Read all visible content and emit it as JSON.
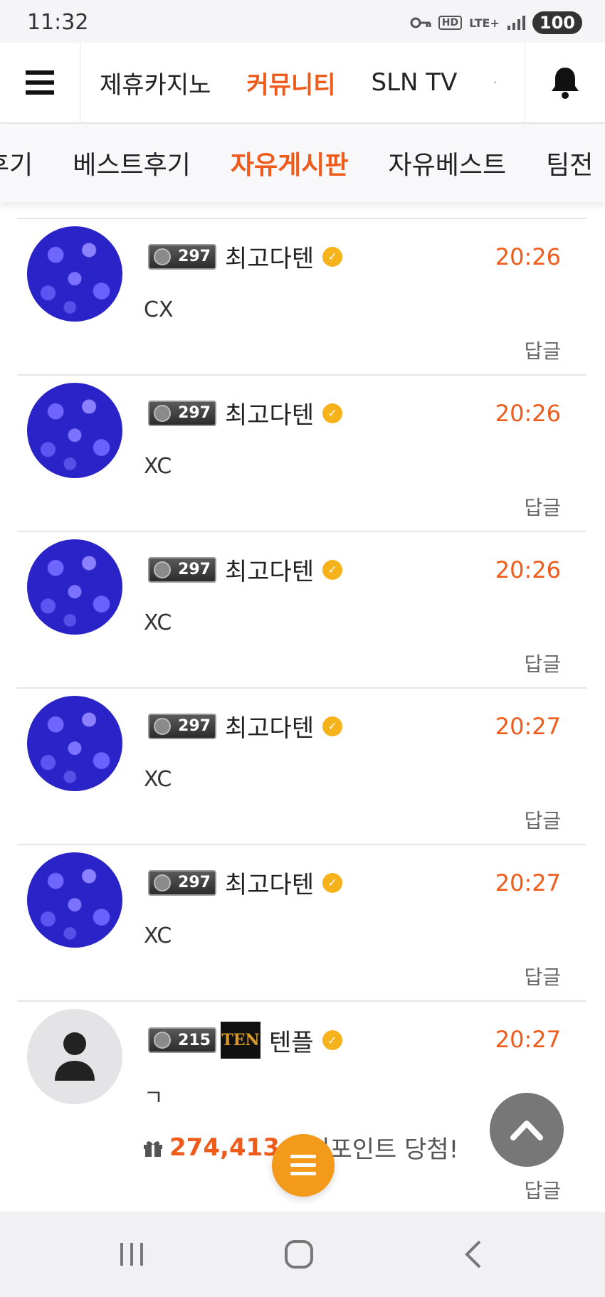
{
  "status": {
    "time": "11:32",
    "battery": "100",
    "network": "LTE+",
    "hd": "HD"
  },
  "topnav": {
    "tabs": [
      "제휴카지노",
      "커뮤니티",
      "SLN TV"
    ],
    "more": "·"
  },
  "subnav": {
    "items": [
      "후기",
      "베스트후기",
      "자유게시판",
      "자유베스트",
      "팀전"
    ]
  },
  "comments": [
    {
      "level": "297",
      "nickname": "최고다텐",
      "time": "20:26",
      "text": "CX",
      "reply": "답글"
    },
    {
      "level": "297",
      "nickname": "최고다텐",
      "time": "20:26",
      "text": "XC",
      "reply": "답글"
    },
    {
      "level": "297",
      "nickname": "최고다텐",
      "time": "20:26",
      "text": "XC",
      "reply": "답글"
    },
    {
      "level": "297",
      "nickname": "최고다텐",
      "time": "20:27",
      "text": "XC",
      "reply": "답글"
    },
    {
      "level": "297",
      "nickname": "최고다텐",
      "time": "20:27",
      "text": "XC",
      "reply": "답글"
    },
    {
      "level": "215",
      "logo": "TEN",
      "nickname": "텐플",
      "time": "20:27",
      "text": "ㄱ",
      "reply": "답글"
    }
  ],
  "points": {
    "number": "274,413",
    "suffix": "랜덤포인트 당첨!"
  },
  "colors": {
    "accent": "#ef5b1b",
    "fab": "#f39a1b",
    "verified": "#f5b21b"
  }
}
